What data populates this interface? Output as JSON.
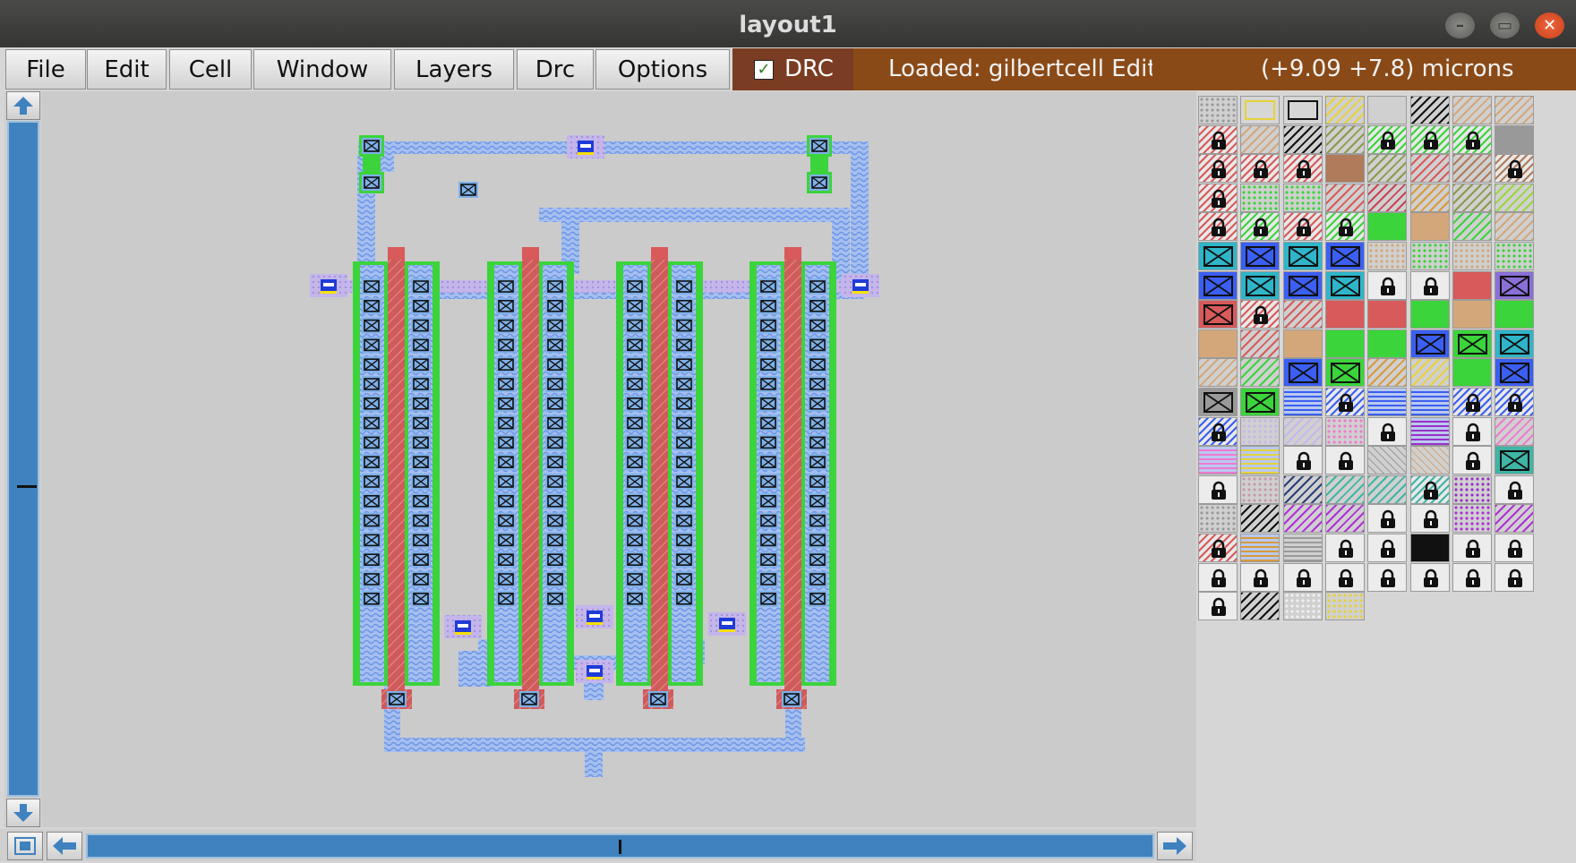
{
  "window": {
    "title": "layout1"
  },
  "menu": [
    "File",
    "Edit",
    "Cell",
    "Window",
    "Layers",
    "Drc",
    "Options"
  ],
  "drc_toggle": {
    "label": "DRC",
    "checked": true
  },
  "status": {
    "message": "Loaded: gilbertcell Editi",
    "coordinates": "(+9.09 +7.8) microns"
  },
  "colors": {
    "titlebar": "#3c3c3a",
    "status_bg": "#8a4a17",
    "drc_bg": "#7a3c22",
    "canvas": "#cbcbcb",
    "diffusion": "#3bd43b",
    "poly": "#d85a5a",
    "metal1": "#7fa9f2",
    "scrollbar": "#3f82bf"
  },
  "palette_rows": [
    [
      "dots",
      "outline-yellow",
      "outline-black",
      "hatch-yellow",
      "plain-gray",
      "hatch-black",
      "hatch-tan",
      "hatch-tan"
    ],
    [
      "lock-red",
      "hatch-tan",
      "hatch-black",
      "hatch-green-brown",
      "lock-green",
      "lock-green",
      "lock-green",
      "solid-red-hatch"
    ],
    [
      "lock-red",
      "lock-red",
      "lock-red",
      "solid-brown",
      "hatch-green-brown",
      "hatch-red",
      "hatch-brown",
      "lock-brown"
    ],
    [
      "lock-red",
      "dots-green",
      "dots-green",
      "hatch-red",
      "hatch-crimson",
      "hatch-orange",
      "hatch-green-brown",
      "hatch-green-yellow"
    ],
    [
      "lock-red",
      "lock-green",
      "lock-red",
      "lock-green",
      "solid-green",
      "solid-tan",
      "hatch-green",
      "hatch-tan"
    ],
    [
      "contact-cyan",
      "contact-blue",
      "contact-cyan",
      "contact-blue",
      "dots-tan",
      "dots-green",
      "dots-tan",
      "dots-green"
    ],
    [
      "contact-blue",
      "contact-cyan",
      "contact-blue",
      "contact-cyan",
      "lock-white",
      "lock-white",
      "solid-red",
      "contact-violet"
    ],
    [
      "contact-red",
      "lock-red",
      "hatch-red",
      "solid-red",
      "solid-red",
      "solid-green",
      "solid-tan",
      "solid-green"
    ],
    [
      "solid-tan",
      "hatch-red",
      "solid-tan",
      "solid-green",
      "solid-green",
      "contact-blue",
      "contact-green",
      "contact-cyan"
    ],
    [
      "hatch-tan",
      "hatch-green",
      "contact-blue",
      "contact-green",
      "hatch-orange",
      "hatch-yellow",
      "solid-green",
      "contact-blue"
    ],
    [
      "contact-gray",
      "contact-green",
      "wave-blue",
      "lock-blue",
      "wave-blue",
      "weave-blue",
      "lock-blue",
      "lock-blue"
    ],
    [
      "lock-blue",
      "dots-lilac",
      "hatch-lilac",
      "dots-pink",
      "lock-white",
      "weave-purple",
      "lock-white",
      "hatch-pink"
    ],
    [
      "weave-pink",
      "weave-yellow",
      "lock-white",
      "lock-white",
      "cross-gray",
      "cross-tan",
      "lock-white",
      "contact-teal"
    ],
    [
      "lock-white",
      "dots-mauve",
      "hatch-navy",
      "hatch-teal",
      "hatch-teal",
      "lock-teal",
      "dots-purple",
      "lock-white"
    ],
    [
      "dots-gray",
      "hatch-black",
      "hatch-magenta",
      "hatch-magenta",
      "lock-white",
      "lock-white",
      "dots-magenta",
      "hatch-magenta"
    ],
    [
      "lock-red",
      "weave-orange",
      "lines-gray",
      "lock-white",
      "lock-white",
      "solid-black",
      "lock-white",
      "lock-white"
    ],
    [
      "lock-white",
      "lock-white",
      "lock-white",
      "lock-white",
      "lock-white",
      "lock-white",
      "lock-white",
      "lock-white"
    ],
    [
      "lock-white",
      "hatch-black",
      "dots-white",
      "dots-yellow"
    ]
  ]
}
